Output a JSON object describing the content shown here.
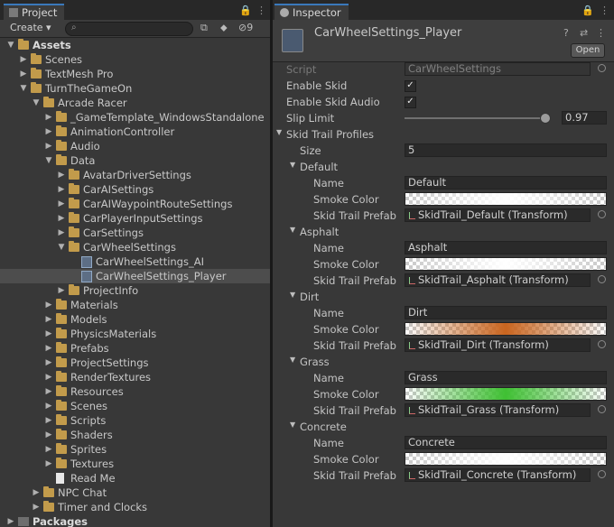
{
  "project": {
    "tab_label": "Project",
    "create_label": "Create ▾",
    "search_placeholder": "",
    "hidden_count": "9",
    "tree": [
      {
        "label": "Assets",
        "depth": 0,
        "arrow": "open",
        "icon": "folder",
        "bold": true
      },
      {
        "label": "Scenes",
        "depth": 1,
        "arrow": "closed",
        "icon": "folder"
      },
      {
        "label": "TextMesh Pro",
        "depth": 1,
        "arrow": "closed",
        "icon": "folder"
      },
      {
        "label": "TurnTheGameOn",
        "depth": 1,
        "arrow": "open",
        "icon": "folder"
      },
      {
        "label": "Arcade Racer",
        "depth": 2,
        "arrow": "open",
        "icon": "folder"
      },
      {
        "label": "_GameTemplate_WindowsStandalone",
        "depth": 3,
        "arrow": "closed",
        "icon": "folder"
      },
      {
        "label": "AnimationController",
        "depth": 3,
        "arrow": "closed",
        "icon": "folder"
      },
      {
        "label": "Audio",
        "depth": 3,
        "arrow": "closed",
        "icon": "folder"
      },
      {
        "label": "Data",
        "depth": 3,
        "arrow": "open",
        "icon": "folder"
      },
      {
        "label": "AvatarDriverSettings",
        "depth": 4,
        "arrow": "closed",
        "icon": "folder"
      },
      {
        "label": "CarAISettings",
        "depth": 4,
        "arrow": "closed",
        "icon": "folder"
      },
      {
        "label": "CarAIWaypointRouteSettings",
        "depth": 4,
        "arrow": "closed",
        "icon": "folder"
      },
      {
        "label": "CarPlayerInputSettings",
        "depth": 4,
        "arrow": "closed",
        "icon": "folder"
      },
      {
        "label": "CarSettings",
        "depth": 4,
        "arrow": "closed",
        "icon": "folder"
      },
      {
        "label": "CarWheelSettings",
        "depth": 4,
        "arrow": "open",
        "icon": "folder"
      },
      {
        "label": "CarWheelSettings_AI",
        "depth": 5,
        "arrow": "none",
        "icon": "so"
      },
      {
        "label": "CarWheelSettings_Player",
        "depth": 5,
        "arrow": "none",
        "icon": "so",
        "selected": true
      },
      {
        "label": "ProjectInfo",
        "depth": 4,
        "arrow": "closed",
        "icon": "folder"
      },
      {
        "label": "Materials",
        "depth": 3,
        "arrow": "closed",
        "icon": "folder"
      },
      {
        "label": "Models",
        "depth": 3,
        "arrow": "closed",
        "icon": "folder"
      },
      {
        "label": "PhysicsMaterials",
        "depth": 3,
        "arrow": "closed",
        "icon": "folder"
      },
      {
        "label": "Prefabs",
        "depth": 3,
        "arrow": "closed",
        "icon": "folder"
      },
      {
        "label": "ProjectSettings",
        "depth": 3,
        "arrow": "closed",
        "icon": "folder"
      },
      {
        "label": "RenderTextures",
        "depth": 3,
        "arrow": "closed",
        "icon": "folder"
      },
      {
        "label": "Resources",
        "depth": 3,
        "arrow": "closed",
        "icon": "folder"
      },
      {
        "label": "Scenes",
        "depth": 3,
        "arrow": "closed",
        "icon": "folder"
      },
      {
        "label": "Scripts",
        "depth": 3,
        "arrow": "closed",
        "icon": "folder"
      },
      {
        "label": "Shaders",
        "depth": 3,
        "arrow": "closed",
        "icon": "folder"
      },
      {
        "label": "Sprites",
        "depth": 3,
        "arrow": "closed",
        "icon": "folder"
      },
      {
        "label": "Textures",
        "depth": 3,
        "arrow": "closed",
        "icon": "folder"
      },
      {
        "label": "Read Me",
        "depth": 3,
        "arrow": "none",
        "icon": "doc"
      },
      {
        "label": "NPC Chat",
        "depth": 2,
        "arrow": "closed",
        "icon": "folder"
      },
      {
        "label": "Timer and Clocks",
        "depth": 2,
        "arrow": "closed",
        "icon": "folder"
      },
      {
        "label": "Packages",
        "depth": 0,
        "arrow": "closed",
        "icon": "pkg",
        "bold": true
      }
    ]
  },
  "inspector": {
    "tab_label": "Inspector",
    "asset_title": "CarWheelSettings_Player",
    "open_label": "Open",
    "script_label": "Script",
    "script_value": "CarWheelSettings",
    "enable_skid_label": "Enable Skid",
    "enable_skid": true,
    "enable_skid_audio_label": "Enable Skid Audio",
    "enable_skid_audio": true,
    "slip_limit_label": "Slip Limit",
    "slip_limit": "0.97",
    "slip_limit_fraction": 0.97,
    "profiles_label": "Skid Trail Profiles",
    "size_label": "Size",
    "size_value": "5",
    "name_label": "Name",
    "smoke_label": "Smoke Color",
    "prefab_label": "Skid Trail Prefab",
    "profiles": [
      {
        "header": "Default",
        "name": "Default",
        "color": "#ffffff",
        "prefab": "SkidTrail_Default (Transform)"
      },
      {
        "header": "Asphalt",
        "name": "Asphalt",
        "color": "#ffffff",
        "prefab": "SkidTrail_Asphalt (Transform)"
      },
      {
        "header": "Dirt",
        "name": "Dirt",
        "color": "#c9651f",
        "prefab": "SkidTrail_Dirt (Transform)"
      },
      {
        "header": "Grass",
        "name": "Grass",
        "color": "#3fc033",
        "prefab": "SkidTrail_Grass (Transform)"
      },
      {
        "header": "Concrete",
        "name": "Concrete",
        "color": "#ffffff",
        "prefab": "SkidTrail_Concrete (Transform)"
      }
    ]
  }
}
